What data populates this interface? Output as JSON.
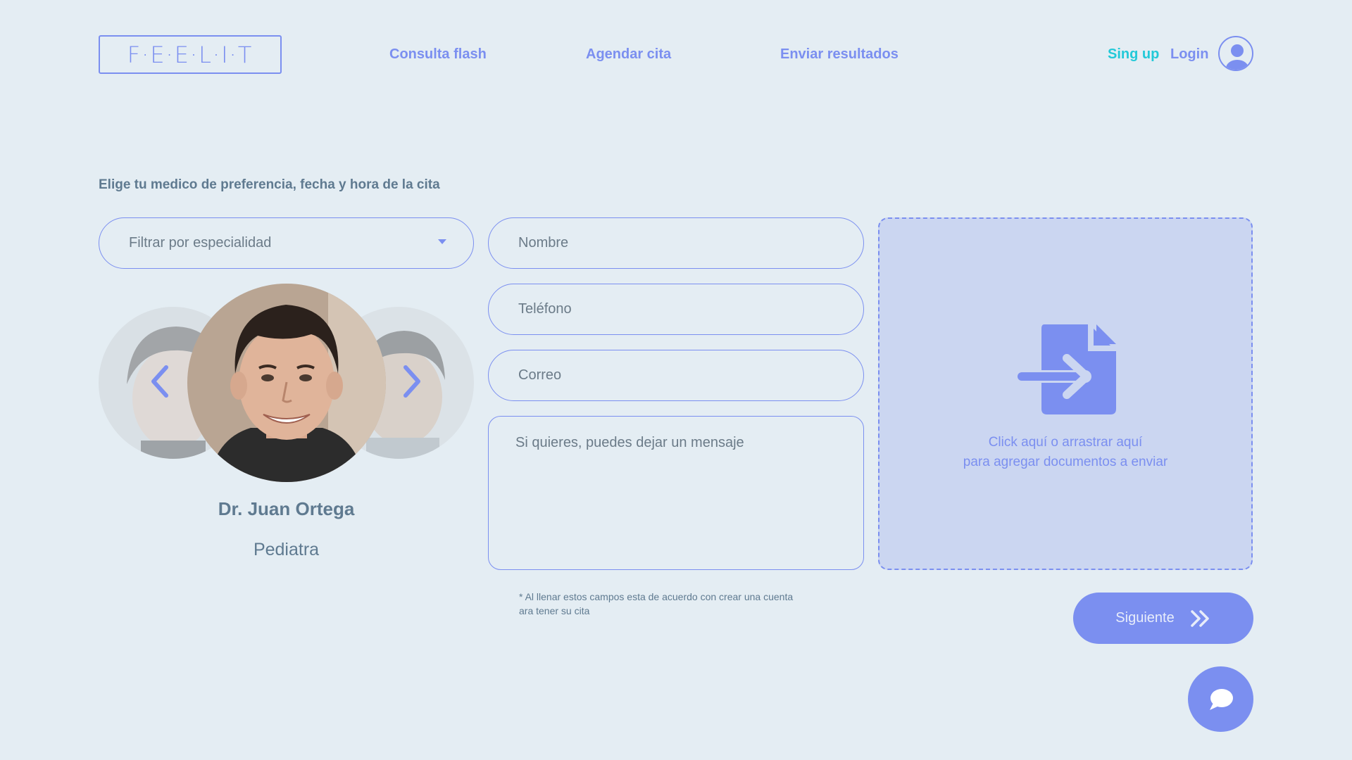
{
  "header": {
    "logo_text": "F·E·E·L·I·T",
    "nav": [
      "Consulta flash",
      "Agendar cita",
      "Enviar resultados"
    ],
    "signup": "Sing up",
    "login": "Login"
  },
  "instruction": "Elige tu medico de preferencia, fecha y hora de la cita",
  "filter": {
    "placeholder": "Filtrar por especialidad"
  },
  "form": {
    "name_placeholder": "Nombre",
    "phone_placeholder": "Teléfono",
    "email_placeholder": "Correo",
    "message_placeholder": "Si quieres, puedes dejar un mensaje",
    "note_line1": "* Al llenar estos campos esta de acuerdo con crear una cuenta",
    "note_line2": "ara tener su cita"
  },
  "doctor": {
    "name": "Dr. Juan Ortega",
    "specialty": "Pediatra"
  },
  "dropzone": {
    "line1": "Click aquí o arrastrar aquí",
    "line2": "para agregar documentos a enviar"
  },
  "next_button": "Siguiente",
  "colors": {
    "accent": "#7b8ff0",
    "signup": "#22c9d8",
    "background": "#e4edf3",
    "dropzone": "#cbd6f1",
    "text": "#5f7a90"
  },
  "icons": [
    "user-avatar-icon",
    "chevron-left-icon",
    "chevron-right-icon",
    "file-import-icon",
    "double-chevron-right-icon",
    "chat-bubble-icon"
  ]
}
